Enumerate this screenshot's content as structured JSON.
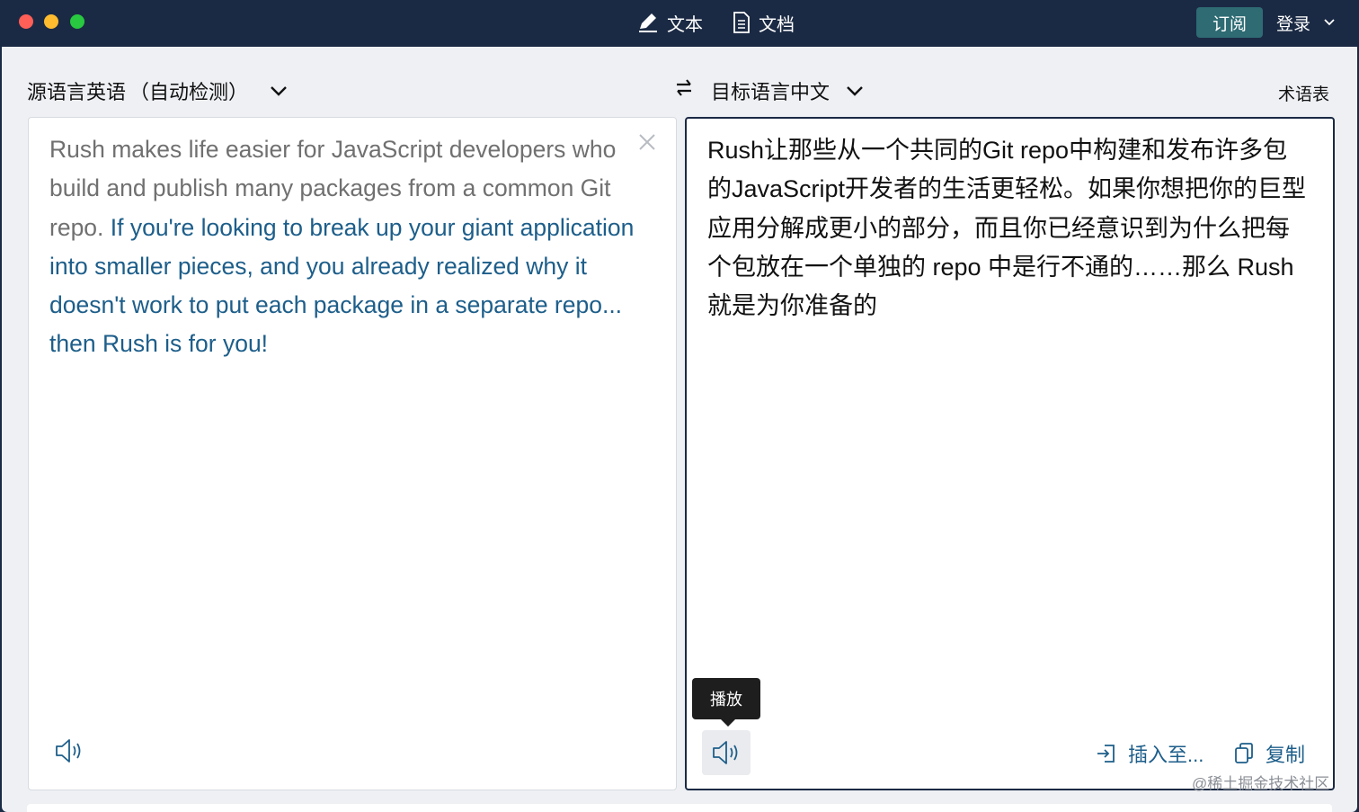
{
  "titlebar": {
    "tab_text": "文本",
    "tab_document": "文档",
    "subscribe": "订阅",
    "login": "登录"
  },
  "source": {
    "lang_label": "源语言英语",
    "lang_auto": "（自动检测）",
    "text_plain": "Rush makes life easier for JavaScript developers who build and publish many packages from a common Git repo.",
    "text_highlight": "If you're looking to break up your giant application into smaller pieces, and you already realized why it doesn't work to put each package in a separate repo... then Rush is for you!"
  },
  "target": {
    "lang_label": "目标语言中文",
    "glossary": "术语表",
    "text": "Rush让那些从一个共同的Git repo中构建和发布许多包的JavaScript开发者的生活更轻松。如果你想把你的巨型应用分解成更小的部分，而且你已经意识到为什么把每个包放在一个单独的 repo 中是行不通的……那么 Rush 就是为你准备的",
    "tooltip": "播放",
    "insert": "插入至...",
    "copy": "复制"
  },
  "watermark": "@稀土掘金技术社区",
  "colors": {
    "titlebar": "#1b2a44",
    "accent": "#1d5e8a",
    "subscribe": "#2e6b73"
  }
}
